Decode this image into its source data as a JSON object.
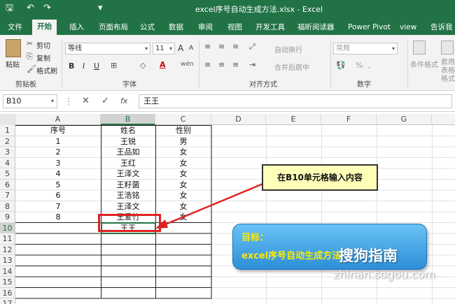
{
  "title_bar": {
    "title": "excel序号自动生成方法.xlsx - Excel",
    "qa_save": "🖫",
    "qa_undo": "↶",
    "qa_redo": "↷",
    "qa_more": "▾"
  },
  "tabs": [
    "文件",
    "开始",
    "插入",
    "页面布局",
    "公式",
    "数据",
    "审阅",
    "视图",
    "开发工具",
    "福昕阅读器",
    "Power Pivot",
    "view",
    "告诉我"
  ],
  "ribbon": {
    "clipboard": {
      "paste": "粘贴",
      "cut": "剪切",
      "copy": "复制",
      "painter": "格式刷",
      "label": "剪贴板"
    },
    "font": {
      "name": "等线",
      "size": "11",
      "grow": "A",
      "shrink": "A",
      "bold": "B",
      "italic": "I",
      "underline": "U",
      "label": "字体"
    },
    "alignment": {
      "wrap": "自动换行",
      "merge": "合并后居中",
      "label": "对齐方式"
    },
    "number": {
      "format": "常规",
      "percent": "%",
      "comma": ",",
      "label": "数字"
    },
    "styles": {
      "conditional": "条件格式",
      "table": "套用\n表格格式"
    }
  },
  "formula_bar": {
    "name_box": "B10",
    "fx": "fx",
    "cancel": "✕",
    "enter": "✓",
    "value": "王王"
  },
  "columns": [
    "A",
    "B",
    "C",
    "D",
    "E",
    "F",
    "G"
  ],
  "rows": [
    "1",
    "2",
    "3",
    "4",
    "5",
    "6",
    "7",
    "8",
    "9",
    "10",
    "11",
    "12",
    "13",
    "14",
    "15",
    "16",
    "17"
  ],
  "table": [
    [
      "序号",
      "姓名",
      "性别"
    ],
    [
      "1",
      "王锐",
      "男"
    ],
    [
      "2",
      "王品如",
      "女"
    ],
    [
      "3",
      "王红",
      "女"
    ],
    [
      "4",
      "王泽文",
      "女"
    ],
    [
      "5",
      "王籽菌",
      "女"
    ],
    [
      "6",
      "王浩铭",
      "女"
    ],
    [
      "7",
      "王泽文",
      "女"
    ],
    [
      "8",
      "王爱竹",
      "女"
    ],
    [
      "",
      "王王",
      ""
    ]
  ],
  "callout": "在B10单元格输入内容",
  "goal": {
    "title": "目标：",
    "text": "excel序号自动生成方法"
  },
  "watermark": {
    "main": "搜狗指南",
    "url": "zhinan.sogou.com"
  },
  "colors": {
    "excel_green": "#217346",
    "callout_bg": "#ffffb8",
    "highlight": "#e02020",
    "goal_blue": "#2d8fd8"
  }
}
